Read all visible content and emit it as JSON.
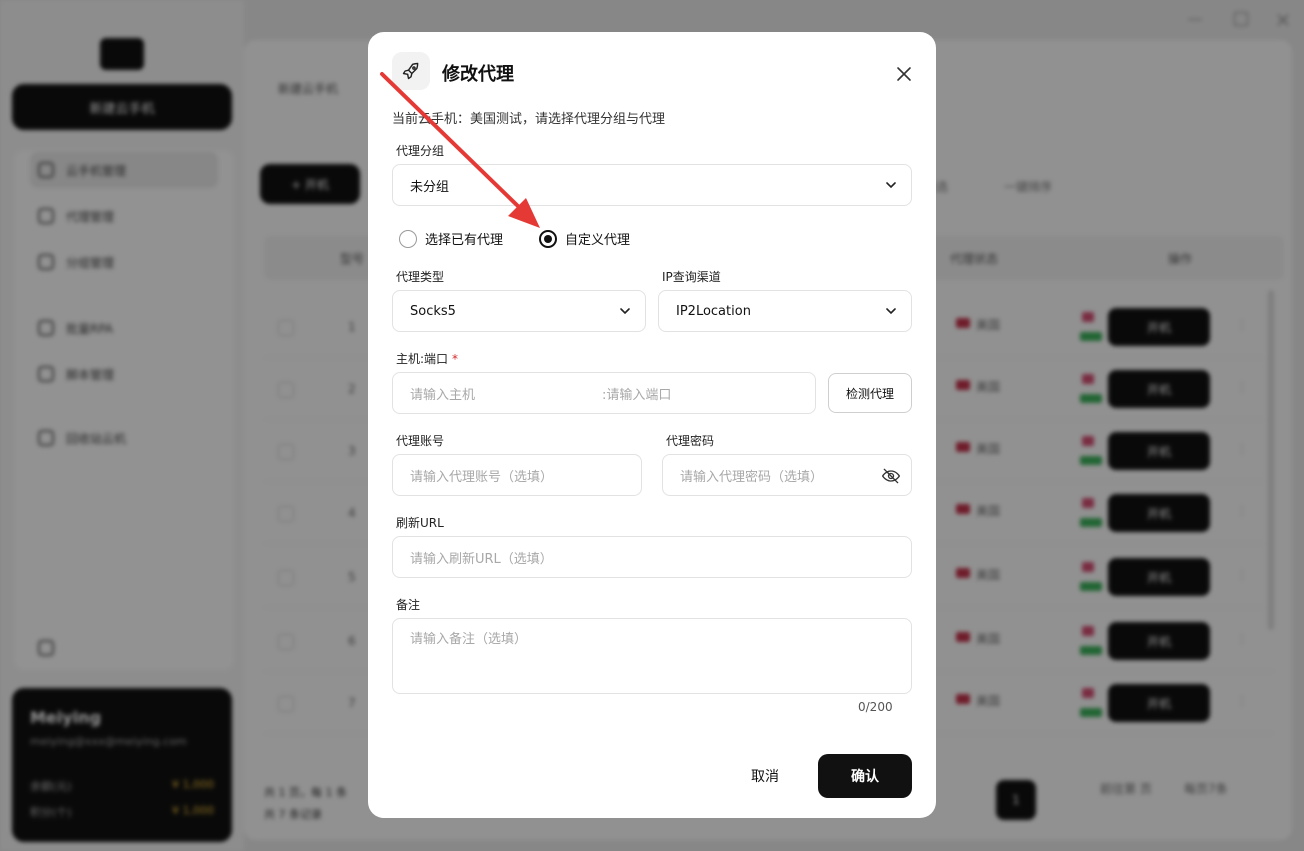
{
  "app": {
    "sidebar": {
      "primary_button": "新建云手机",
      "items": [
        {
          "label": "云手机管理",
          "active": true
        },
        {
          "label": "代理管理"
        },
        {
          "label": "分组管理"
        },
        {
          "label": "批量RPA"
        },
        {
          "label": "脚本管理"
        },
        {
          "label": "回收站云机"
        }
      ],
      "user": {
        "name": "Meiying",
        "email": "meiying@xxx@meiying.com",
        "rows": [
          {
            "label": "余额(元)",
            "value": "¥ 1,000"
          },
          {
            "label": "积分(个)",
            "value": "¥ 1,000"
          }
        ]
      }
    },
    "main": {
      "tab": "新建云手机",
      "add_button": "+ 开机",
      "toolbar_right": [
        "全选",
        "一键排序"
      ],
      "headers": [
        "型号",
        "代理状态",
        "操作"
      ],
      "row_count": 7,
      "row_action": "开机",
      "row_country": "美国",
      "footer": [
        "共 1 页，每 1 条",
        "共 7 条记录"
      ],
      "pagination": {
        "current": "1",
        "per_page": "每页7条",
        "jump": "前往第 页"
      }
    }
  },
  "modal": {
    "title": "修改代理",
    "description": "当前云手机：美国测试，请选择代理分组与代理",
    "group": {
      "label": "代理分组",
      "value": "未分组"
    },
    "mode": {
      "options": [
        "选择已有代理",
        "自定义代理"
      ],
      "selected": "自定义代理"
    },
    "proxy_type": {
      "label": "代理类型",
      "value": "Socks5"
    },
    "ip_channel": {
      "label": "IP查询渠道",
      "value": "IP2Location"
    },
    "host_port": {
      "label": "主机:端口",
      "required_mark": "*",
      "host_placeholder": "请输入主机",
      "port_placeholder": ":请输入端口",
      "detect_button": "检测代理"
    },
    "account": {
      "label": "代理账号",
      "placeholder": "请输入代理账号（选填）"
    },
    "password": {
      "label": "代理密码",
      "placeholder": "请输入代理密码（选填）"
    },
    "refresh_url": {
      "label": "刷新URL",
      "placeholder": "请输入刷新URL（选填）"
    },
    "note": {
      "label": "备注",
      "placeholder": "请输入备注（选填）",
      "counter": "0/200"
    },
    "buttons": {
      "cancel": "取消",
      "confirm": "确认"
    }
  },
  "colors": {
    "accent": "#111111",
    "arrow": "#e53935",
    "required": "#d62a2a"
  }
}
